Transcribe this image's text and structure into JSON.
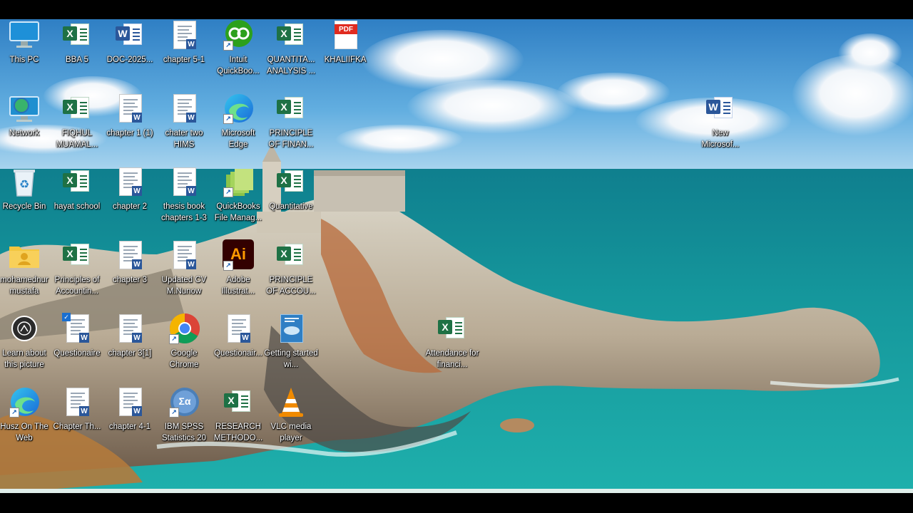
{
  "desktop": {
    "icons": [
      {
        "label": "This PC",
        "icon": "monitor-icon"
      },
      {
        "label": "BBA 5",
        "icon": "excel-file-icon"
      },
      {
        "label": "DOC-2025...",
        "icon": "word-file-icon"
      },
      {
        "label": "chapter 5-1",
        "icon": "word-doc-thumbnail-icon"
      },
      {
        "label": "Intuit QuickBoo...",
        "icon": "quickbooks-icon"
      },
      {
        "label": "QUANTITA... ANALYSIS ...",
        "icon": "excel-file-icon"
      },
      {
        "label": "KHALIIFKA",
        "icon": "pdf-file-icon",
        "badge": "PDF"
      },
      {
        "label": "Network",
        "icon": "network-icon"
      },
      {
        "label": "FIQHUL MUAMAL...",
        "icon": "excel-file-icon"
      },
      {
        "label": "chapter 1 (1)",
        "icon": "word-doc-thumbnail-icon"
      },
      {
        "label": "chater two HIMS",
        "icon": "word-doc-thumbnail-icon"
      },
      {
        "label": "Microsoft Edge",
        "icon": "edge-icon"
      },
      {
        "label": "PRINCIPLE OF FINAN...",
        "icon": "excel-file-icon"
      },
      {
        "label": "New Microsof...",
        "icon": "word-file-icon"
      },
      {
        "label": "Recycle Bin",
        "icon": "recycle-bin-icon"
      },
      {
        "label": "hayat school",
        "icon": "excel-file-icon"
      },
      {
        "label": "chapter 2",
        "icon": "word-doc-thumbnail-icon"
      },
      {
        "label": "thesis book chapters 1-3",
        "icon": "word-doc-thumbnail-icon"
      },
      {
        "label": "QuickBooks File Manag...",
        "icon": "quickbooks-file-manager-icon"
      },
      {
        "label": "Quantitative",
        "icon": "excel-file-icon"
      },
      {
        "label": "mohamednur mustafa",
        "icon": "user-folder-icon"
      },
      {
        "label": "Principles of Accountin...",
        "icon": "excel-file-icon"
      },
      {
        "label": "chapter 3",
        "icon": "word-doc-thumbnail-icon"
      },
      {
        "label": "Updated CV M.Nunow",
        "icon": "word-doc-thumbnail-icon"
      },
      {
        "label": "Adobe Illustrat...",
        "icon": "illustrator-icon",
        "badge": "Ai"
      },
      {
        "label": "PRINCIPLE OF ACCOU...",
        "icon": "excel-file-icon"
      },
      {
        "label": "Learn about this picture",
        "icon": "learn-about-picture-icon"
      },
      {
        "label": "Questionaire",
        "icon": "word-doc-thumbnail-icon"
      },
      {
        "label": "chapter 3[1]",
        "icon": "word-doc-thumbnail-icon"
      },
      {
        "label": "Google Chrome",
        "icon": "chrome-icon"
      },
      {
        "label": "Questionair...",
        "icon": "word-doc-thumbnail-icon"
      },
      {
        "label": "Getting started wi...",
        "icon": "getting-started-icon"
      },
      {
        "label": "Attendance for financi...",
        "icon": "excel-file-icon"
      },
      {
        "label": "Husz On The Web",
        "icon": "edge-icon"
      },
      {
        "label": "Chapter Th...",
        "icon": "word-doc-thumbnail-icon"
      },
      {
        "label": "chapter 4-1",
        "icon": "word-doc-thumbnail-icon"
      },
      {
        "label": "IBM SPSS Statistics 20",
        "icon": "spss-icon"
      },
      {
        "label": "RESEARCH METHODO...",
        "icon": "excel-file-icon"
      },
      {
        "label": "VLC media player",
        "icon": "vlc-icon"
      }
    ]
  },
  "colors": {
    "excel": "#1e7145",
    "word": "#2b579a",
    "pdf": "#e02b20",
    "illustrator_bg": "#330000",
    "illustrator_fg": "#ff9a00"
  },
  "badges": {
    "excel_letter": "X",
    "word_letter": "W",
    "spss_symbol": "Σα"
  }
}
